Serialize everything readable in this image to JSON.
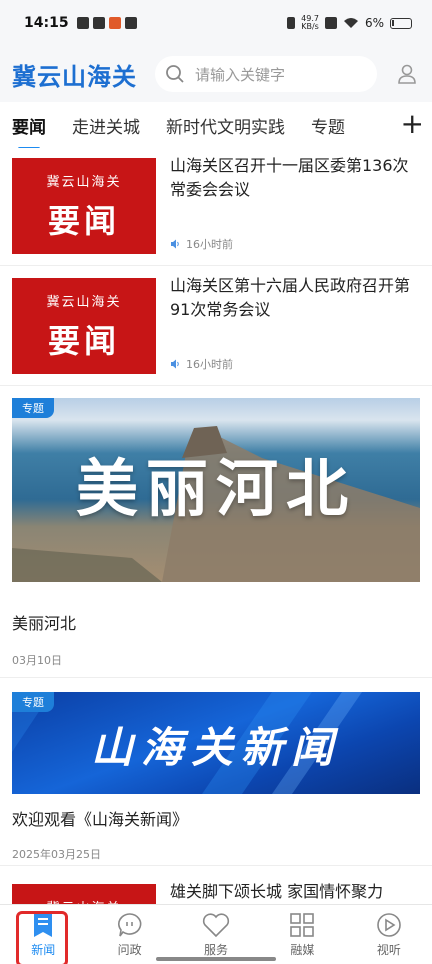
{
  "status_bar": {
    "time": "14:15",
    "net_speed_top": "49.7",
    "net_speed_unit": "KB/s",
    "battery": "6%"
  },
  "header": {
    "logo": "冀云山海关",
    "search_placeholder": "请输入关键字"
  },
  "tabs": [
    {
      "label": "要闻",
      "active": true
    },
    {
      "label": "走进关城"
    },
    {
      "label": "新时代文明实践"
    },
    {
      "label": "专题"
    }
  ],
  "thumb_brand": "冀云山海关",
  "thumb_big": "要闻",
  "news": [
    {
      "title": "山海关区召开十一届区委第136次常委会会议",
      "time": "16小时前"
    },
    {
      "title": "山海关区第十六届人民政府召开第91次常务会议",
      "time": "16小时前"
    }
  ],
  "specials": [
    {
      "badge": "专题",
      "banner_text": "美丽河北",
      "title": "美丽河北",
      "date": "03月10日"
    },
    {
      "badge": "专题",
      "banner_text": "山海关新闻",
      "title": "欢迎观看《山海关新闻》",
      "date": "2025年03月25日"
    }
  ],
  "partial_news": {
    "title": "雄关脚下颂长城 家国情怀聚力"
  },
  "bottom_nav": [
    {
      "label": "新闻",
      "icon": "news-icon",
      "active": true
    },
    {
      "label": "问政",
      "icon": "chat-icon"
    },
    {
      "label": "服务",
      "icon": "heart-icon"
    },
    {
      "label": "融媒",
      "icon": "grid-icon"
    },
    {
      "label": "视听",
      "icon": "play-icon"
    }
  ],
  "colors": {
    "accent": "#1d8bf1",
    "brand_blue": "#1d6fd1",
    "news_red": "#c71516",
    "highlight": "#e12a2a"
  }
}
